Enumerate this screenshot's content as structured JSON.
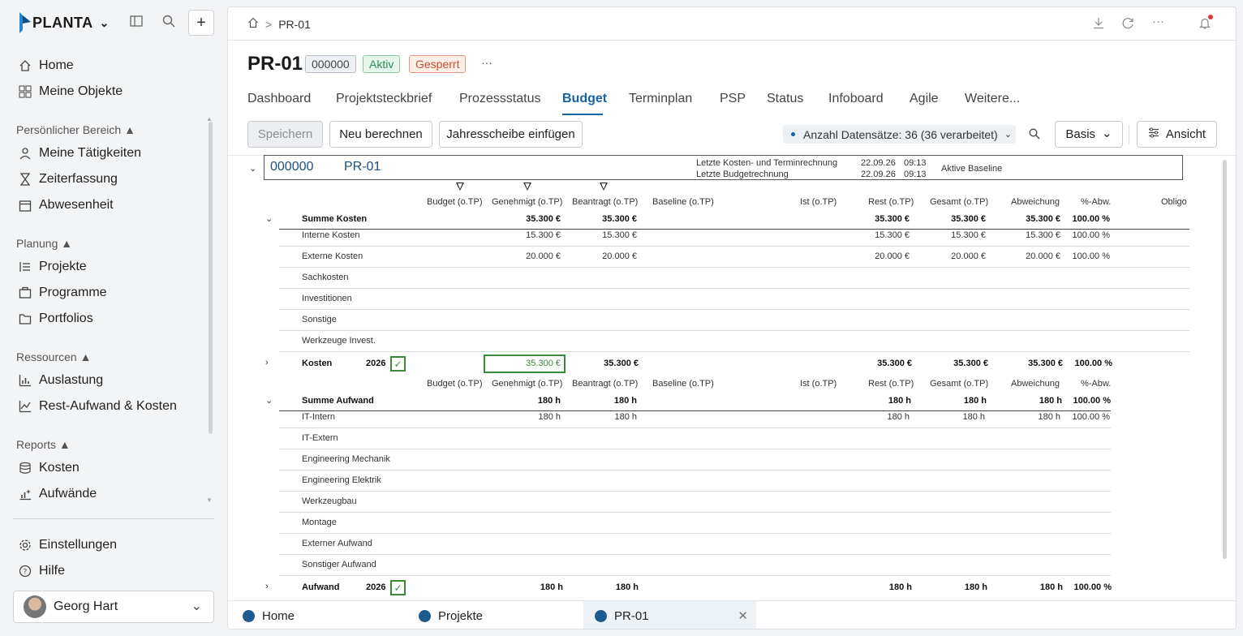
{
  "sidebar": {
    "brand": "PLANTA",
    "nav_top": [
      {
        "label": "Home",
        "icon": "home-icon"
      },
      {
        "label": "Meine Objekte",
        "icon": "grid-icon"
      }
    ],
    "sections": [
      {
        "title": "Persönlicher Bereich",
        "items": [
          {
            "label": "Meine Tätigkeiten",
            "icon": "person-icon"
          },
          {
            "label": "Zeiterfassung",
            "icon": "hourglass-icon"
          },
          {
            "label": "Abwesenheit",
            "icon": "calendar-icon"
          }
        ]
      },
      {
        "title": "Planung",
        "items": [
          {
            "label": "Projekte",
            "icon": "project-list-icon"
          },
          {
            "label": "Programme",
            "icon": "briefcase-icon"
          },
          {
            "label": "Portfolios",
            "icon": "folder-icon"
          }
        ]
      },
      {
        "title": "Ressourcen",
        "items": [
          {
            "label": "Auslastung",
            "icon": "bar-chart-icon"
          },
          {
            "label": "Rest-Aufwand & Kosten",
            "icon": "trend-icon"
          }
        ]
      },
      {
        "title": "Reports",
        "items": [
          {
            "label": "Kosten",
            "icon": "coins-icon"
          },
          {
            "label": "Aufwände",
            "icon": "sparkle-chart-icon"
          }
        ]
      }
    ],
    "nav_bottom": [
      {
        "label": "Einstellungen",
        "icon": "gear-icon"
      },
      {
        "label": "Hilfe",
        "icon": "help-icon"
      }
    ],
    "user": "Georg Hart"
  },
  "header": {
    "breadcrumb": "PR-01",
    "title": "PR-01",
    "id_badge": "000000",
    "status_badge": "Aktiv",
    "lock_badge": "Gesperrt",
    "more": "···"
  },
  "tabs": [
    "Dashboard",
    "Projektsteckbrief",
    "Prozessstatus",
    "Budget",
    "Terminplan",
    "PSP",
    "Status",
    "Infoboard",
    "Agile",
    "Weitere..."
  ],
  "active_tab": "Budget",
  "toolbar": {
    "save": "Speichern",
    "recalc": "Neu berechnen",
    "insert_year": "Jahresscheibe einfügen",
    "records": "Anzahl Datensätze: 36 (36 verarbeitet)",
    "basis": "Basis",
    "view": "Ansicht"
  },
  "project_header": {
    "number": "000000",
    "name": "PR-01",
    "last_cost_label": "Letzte Kosten- und Terminrechnung",
    "last_cost_date": "22.09.26",
    "last_cost_time": "09:13",
    "last_budget_label": "Letzte Budgetrechnung",
    "last_budget_date": "22.09.26",
    "last_budget_time": "09:13",
    "baseline_label": "Aktive Baseline"
  },
  "columns": [
    "Budget (o.TP)",
    "Genehmigt (o.TP)",
    "Beantragt (o.TP)",
    "Baseline (o.TP)",
    "Ist (o.TP)",
    "Rest (o.TP)",
    "Gesamt (o.TP)",
    "Abweichung",
    "%-Abw.",
    "Obligo"
  ],
  "kosten": {
    "sum_label": "Summe Kosten",
    "sum_values": {
      "genehmigt": "35.300 €",
      "beantragt": "35.300 €",
      "rest": "35.300 €",
      "gesamt": "35.300 €",
      "abw": "35.300 €",
      "pct": "100.00 %"
    },
    "rows": [
      {
        "label": "Interne Kosten",
        "genehmigt": "15.300 €",
        "beantragt": "15.300 €",
        "rest": "15.300 €",
        "gesamt": "15.300 €",
        "abw": "15.300 €",
        "pct": "100.00 %"
      },
      {
        "label": "Externe Kosten",
        "genehmigt": "20.000 €",
        "beantragt": "20.000 €",
        "rest": "20.000 €",
        "gesamt": "20.000 €",
        "abw": "20.000 €",
        "pct": "100.00 %"
      },
      {
        "label": "Sachkosten"
      },
      {
        "label": "Investitionen"
      },
      {
        "label": "Sonstige"
      },
      {
        "label": "Werkzeuge Invest."
      }
    ],
    "year_label": "Kosten",
    "year": "2026",
    "year_genehmigt": "35.300 €",
    "year_beantragt": "35.300 €",
    "year_rest": "35.300 €",
    "year_gesamt": "35.300 €",
    "year_abw": "35.300 €",
    "year_pct": "100.00 %"
  },
  "aufwand": {
    "sum_label": "Summe Aufwand",
    "sum_values": {
      "genehmigt": "180 h",
      "beantragt": "180 h",
      "rest": "180 h",
      "gesamt": "180 h",
      "abw": "180 h",
      "pct": "100.00 %"
    },
    "rows": [
      {
        "label": "IT-Intern",
        "genehmigt": "180 h",
        "beantragt": "180 h",
        "rest": "180 h",
        "gesamt": "180 h",
        "abw": "180 h",
        "pct": "100.00 %"
      },
      {
        "label": "IT-Extern"
      },
      {
        "label": "Engineering Mechanik"
      },
      {
        "label": "Engineering Elektrik"
      },
      {
        "label": "Werkzeugbau"
      },
      {
        "label": "Montage"
      },
      {
        "label": "Externer Aufwand"
      },
      {
        "label": "Sonstiger Aufwand"
      }
    ],
    "year_label": "Aufwand",
    "year": "2026",
    "year_genehmigt": "180 h",
    "year_beantragt": "180 h",
    "year_rest": "180 h",
    "year_gesamt": "180 h",
    "year_abw": "180 h",
    "year_pct": "100.00 %"
  },
  "bottom_tabs": [
    "Home",
    "Projekte",
    "PR-01"
  ],
  "colors": {
    "accent": "#1764a3",
    "aktiv": "#2e8b57",
    "gesperrt": "#c8502f"
  }
}
